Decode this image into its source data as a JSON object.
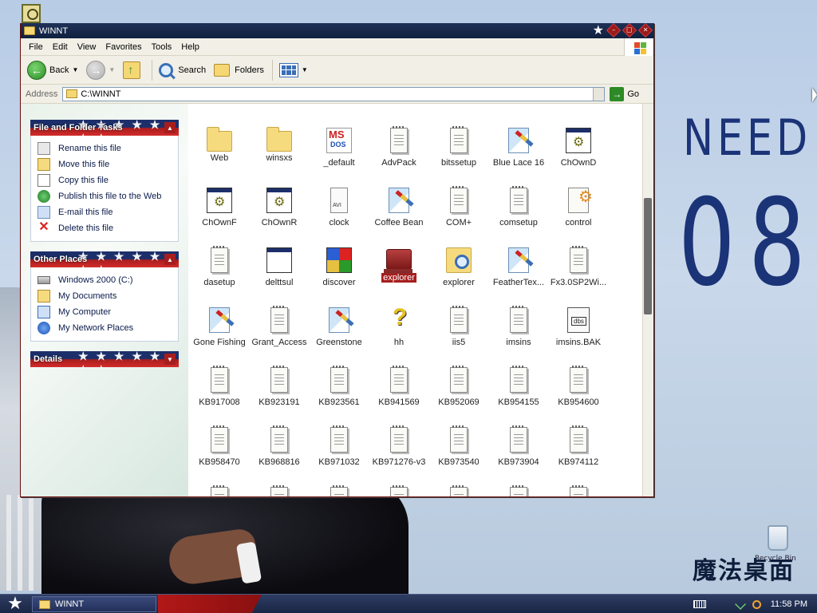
{
  "desktop": {
    "bg_word": "NEED",
    "bg_year": "08",
    "brand": "魔法桌面",
    "recycle_bin": "Recycle Bin"
  },
  "window": {
    "title": "WINNT",
    "title_icon": "folder-icon",
    "accent": "#1d2f6a",
    "accent_red": "#a71d1d"
  },
  "menu": [
    "File",
    "Edit",
    "View",
    "Favorites",
    "Tools",
    "Help"
  ],
  "toolbar": {
    "back": "Back",
    "search": "Search",
    "folders": "Folders"
  },
  "address": {
    "label": "Address",
    "value": "C:\\WINNT",
    "go": "Go"
  },
  "tasks_panel": {
    "title": "File and Folder Tasks",
    "items": [
      {
        "label": "Rename this file",
        "icon": "rename-icon"
      },
      {
        "label": "Move this file",
        "icon": "move-icon"
      },
      {
        "label": "Copy this file",
        "icon": "copy-icon"
      },
      {
        "label": "Publish this file to the Web",
        "icon": "globe-icon"
      },
      {
        "label": "E-mail this file",
        "icon": "email-icon"
      },
      {
        "label": "Delete this file",
        "icon": "delete-icon"
      }
    ]
  },
  "places_panel": {
    "title": "Other Places",
    "items": [
      {
        "label": "Windows 2000 (C:)",
        "icon": "drive-icon"
      },
      {
        "label": "My Documents",
        "icon": "documents-icon"
      },
      {
        "label": "My Computer",
        "icon": "computer-icon"
      },
      {
        "label": "My Network Places",
        "icon": "network-icon"
      }
    ]
  },
  "details_panel": {
    "title": "Details"
  },
  "files": [
    {
      "name": "Web",
      "icon": "folder"
    },
    {
      "name": "winsxs",
      "icon": "folder"
    },
    {
      "name": "_default",
      "icon": "ms"
    },
    {
      "name": "AdvPack",
      "icon": "doc"
    },
    {
      "name": "bitssetup",
      "icon": "doc"
    },
    {
      "name": "Blue Lace 16",
      "icon": "paint"
    },
    {
      "name": "ChOwnD",
      "icon": "app"
    },
    {
      "name": "ChOwnF",
      "icon": "app"
    },
    {
      "name": "ChOwnR",
      "icon": "app"
    },
    {
      "name": "clock",
      "icon": "clock"
    },
    {
      "name": "Coffee Bean",
      "icon": "paint"
    },
    {
      "name": "COM+",
      "icon": "doc"
    },
    {
      "name": "comsetup",
      "icon": "doc"
    },
    {
      "name": "control",
      "icon": "control"
    },
    {
      "name": "dasetup",
      "icon": "doc"
    },
    {
      "name": "delttsul",
      "icon": "window"
    },
    {
      "name": "discover",
      "icon": "discover"
    },
    {
      "name": "explorer",
      "icon": "explorer",
      "selected": true
    },
    {
      "name": "explorer",
      "icon": "search"
    },
    {
      "name": "FeatherTex...",
      "icon": "paint"
    },
    {
      "name": "Fx3.0SP2Wi...",
      "icon": "doc"
    },
    {
      "name": "Gone Fishing",
      "icon": "paint"
    },
    {
      "name": "Grant_Access",
      "icon": "doc"
    },
    {
      "name": "Greenstone",
      "icon": "paint"
    },
    {
      "name": "hh",
      "icon": "hh"
    },
    {
      "name": "iis5",
      "icon": "doc"
    },
    {
      "name": "imsins",
      "icon": "doc"
    },
    {
      "name": "imsins.BAK",
      "icon": "bak"
    },
    {
      "name": "KB917008",
      "icon": "doc"
    },
    {
      "name": "KB923191",
      "icon": "doc"
    },
    {
      "name": "KB923561",
      "icon": "doc"
    },
    {
      "name": "KB941569",
      "icon": "doc"
    },
    {
      "name": "KB952069",
      "icon": "doc"
    },
    {
      "name": "KB954155",
      "icon": "doc"
    },
    {
      "name": "KB954600",
      "icon": "doc"
    },
    {
      "name": "KB958470",
      "icon": "doc"
    },
    {
      "name": "KB968816",
      "icon": "doc"
    },
    {
      "name": "KB971032",
      "icon": "doc"
    },
    {
      "name": "KB971276-v3",
      "icon": "doc"
    },
    {
      "name": "KB973540",
      "icon": "doc"
    },
    {
      "name": "KB973904",
      "icon": "doc"
    },
    {
      "name": "KB974112",
      "icon": "doc"
    }
  ],
  "taskbar": {
    "task": "WINNT",
    "clock": "11:58 PM"
  }
}
